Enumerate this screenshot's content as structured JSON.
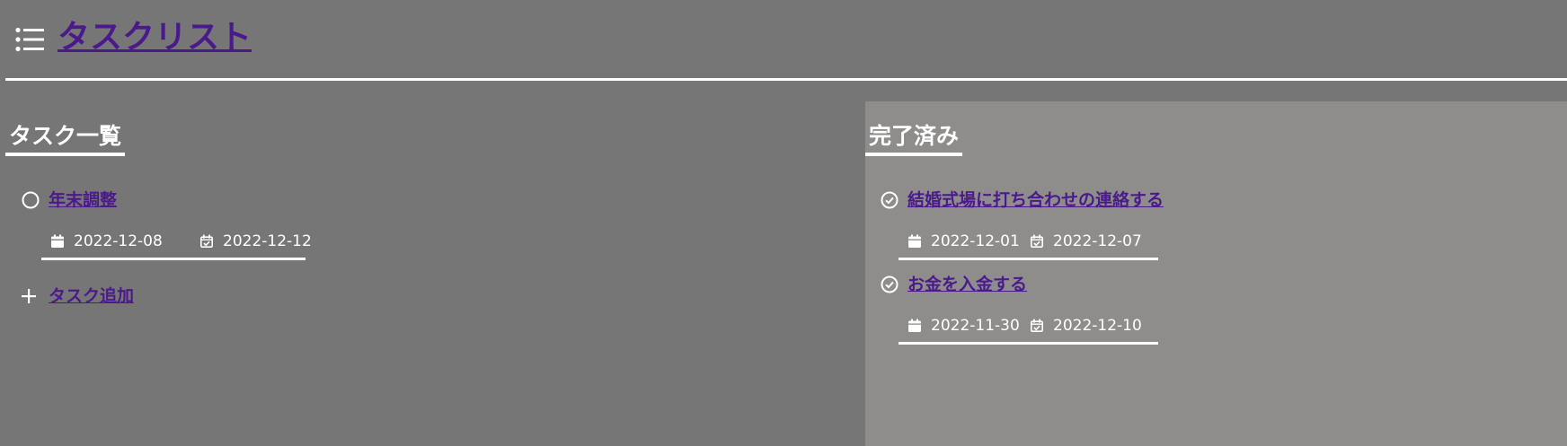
{
  "app": {
    "title": "タスクリスト",
    "menu_icon": "list-icon"
  },
  "todo": {
    "title": "タスク一覧",
    "tasks": [
      {
        "name": "年末調整",
        "status_icon": "circle-outline-icon",
        "start_icon": "calendar-icon",
        "start_date": "2022-12-08",
        "due_icon": "calendar-check-icon",
        "due_date": "2022-12-12"
      }
    ],
    "add_label": "タスク追加",
    "add_icon": "plus-icon"
  },
  "done": {
    "title": "完了済み",
    "tasks": [
      {
        "name": "結婚式場に打ち合わせの連絡する",
        "status_icon": "check-circle-icon",
        "start_icon": "calendar-icon",
        "start_date": "2022-12-01",
        "due_icon": "calendar-check-icon",
        "due_date": "2022-12-07"
      },
      {
        "name": "お金を入金する",
        "status_icon": "check-circle-icon",
        "start_icon": "calendar-icon",
        "start_date": "2022-11-30",
        "due_icon": "calendar-check-icon",
        "due_date": "2022-12-10"
      }
    ]
  },
  "colors": {
    "background": "#767676",
    "done_panel": "#8e8d8b",
    "link": "#4a1a8c",
    "text": "#ffffff"
  }
}
